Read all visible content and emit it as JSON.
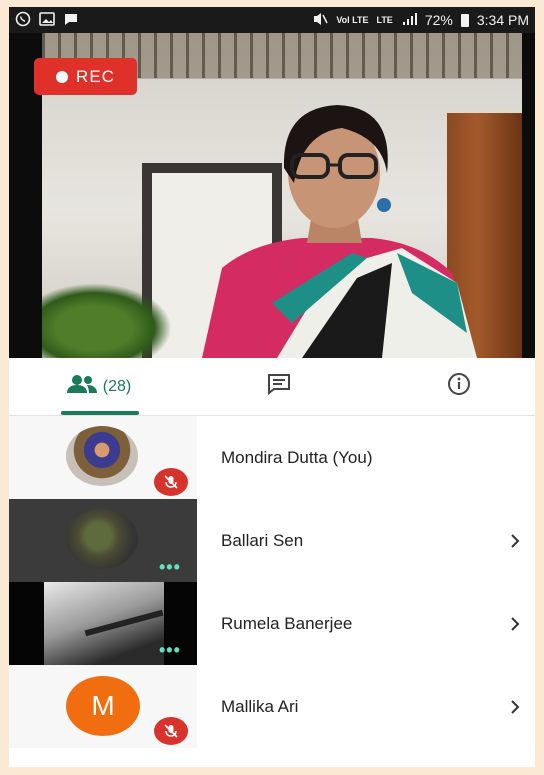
{
  "status_bar": {
    "time": "3:34 PM",
    "battery": "72%",
    "network_a": "Vol LTE",
    "network_b": "LTE",
    "left_icons": [
      "whatsapp-icon",
      "image-icon",
      "chat-bubble-icon"
    ]
  },
  "video": {
    "recording_label": "REC"
  },
  "tabs": {
    "people_count": "(28)",
    "items": [
      "people-tab",
      "chat-tab",
      "info-tab"
    ]
  },
  "participants": [
    {
      "name": "Mondira Dutta (You)",
      "avatar": "photo",
      "muted": true,
      "has_chevron": false
    },
    {
      "name": "Ballari Sen",
      "avatar": "blur",
      "muted": false,
      "has_chevron": true
    },
    {
      "name": "Rumela Banerjee",
      "avatar": "video",
      "muted": false,
      "has_chevron": true
    },
    {
      "name": "Mallika Ari",
      "avatar": "letter",
      "avatar_letter": "M",
      "muted": true,
      "has_chevron": true
    }
  ],
  "colors": {
    "accent": "#1a7a5a",
    "rec": "#e0302a",
    "avatar_orange": "#f06e10",
    "mute_red": "#d8322d"
  }
}
